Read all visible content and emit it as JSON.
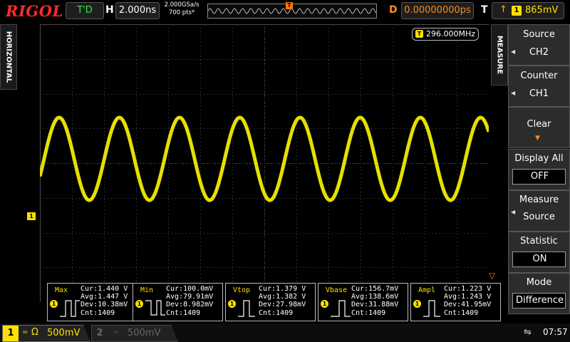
{
  "brand": "RIGOL",
  "top": {
    "run_status": "T'D",
    "horizontal_label": "H",
    "timebase": "2.000ns",
    "sample_rate": "2.000GSa/s",
    "points": "700 pts*",
    "delay_label": "D",
    "delay": "0.00000000ps",
    "trigger_label": "T",
    "trigger_source": "1",
    "trigger_level": "865mV"
  },
  "left_tab": "HORIZONTAL",
  "display": {
    "ch1_marker": "1",
    "trigger_marker": "T",
    "frequency_counter": "296.000MHz",
    "counter_icon": "T",
    "waveform_color": "#e6e000",
    "grid_color": "#4a4a4a"
  },
  "measure_panel": {
    "tab": "MEASURE",
    "items": [
      {
        "title": "Source",
        "value": "CH2"
      },
      {
        "title": "Counter",
        "value": "CH1"
      },
      {
        "title": "Clear",
        "value": ""
      },
      {
        "title": "Display All",
        "value": "OFF"
      },
      {
        "title": "Measure",
        "value": "Source"
      },
      {
        "title": "Statistic",
        "value": "ON"
      },
      {
        "title": "Mode",
        "value": "Difference"
      }
    ]
  },
  "measurements": [
    {
      "name": "Max",
      "cur": "Cur:1.440 V",
      "avg": "Avg:1.447 V",
      "dev": "Dev:10.38mV",
      "cnt": "Cnt:1409"
    },
    {
      "name": "Min",
      "cur": "Cur:100.0mV",
      "avg": "Avg:79.91mV",
      "dev": "Dev:8.982mV",
      "cnt": "Cnt:1409"
    },
    {
      "name": "Vtop",
      "cur": "Cur:1.379 V",
      "avg": "Avg:1.382 V",
      "dev": "Dev:27.98mV",
      "cnt": "Cnt:1409"
    },
    {
      "name": "Vbase",
      "cur": "Cur:156.7mV",
      "avg": "Avg:138.6mV",
      "dev": "Dev:31.88mV",
      "cnt": "Cnt:1409"
    },
    {
      "name": "Ampl",
      "cur": "Cur:1.223 V",
      "avg": "Avg:1.243 V",
      "dev": "Dev:41.95mV",
      "cnt": "Cnt:1409"
    }
  ],
  "status": {
    "ch1_num": "1",
    "ch1_coupling": "=",
    "ch1_impedance": "Ω",
    "ch1_scale": "500mV",
    "ch2_num": "2",
    "ch2_coupling": "=",
    "ch2_scale": "500mV",
    "usb": "usb-icon",
    "time": "07:57"
  }
}
